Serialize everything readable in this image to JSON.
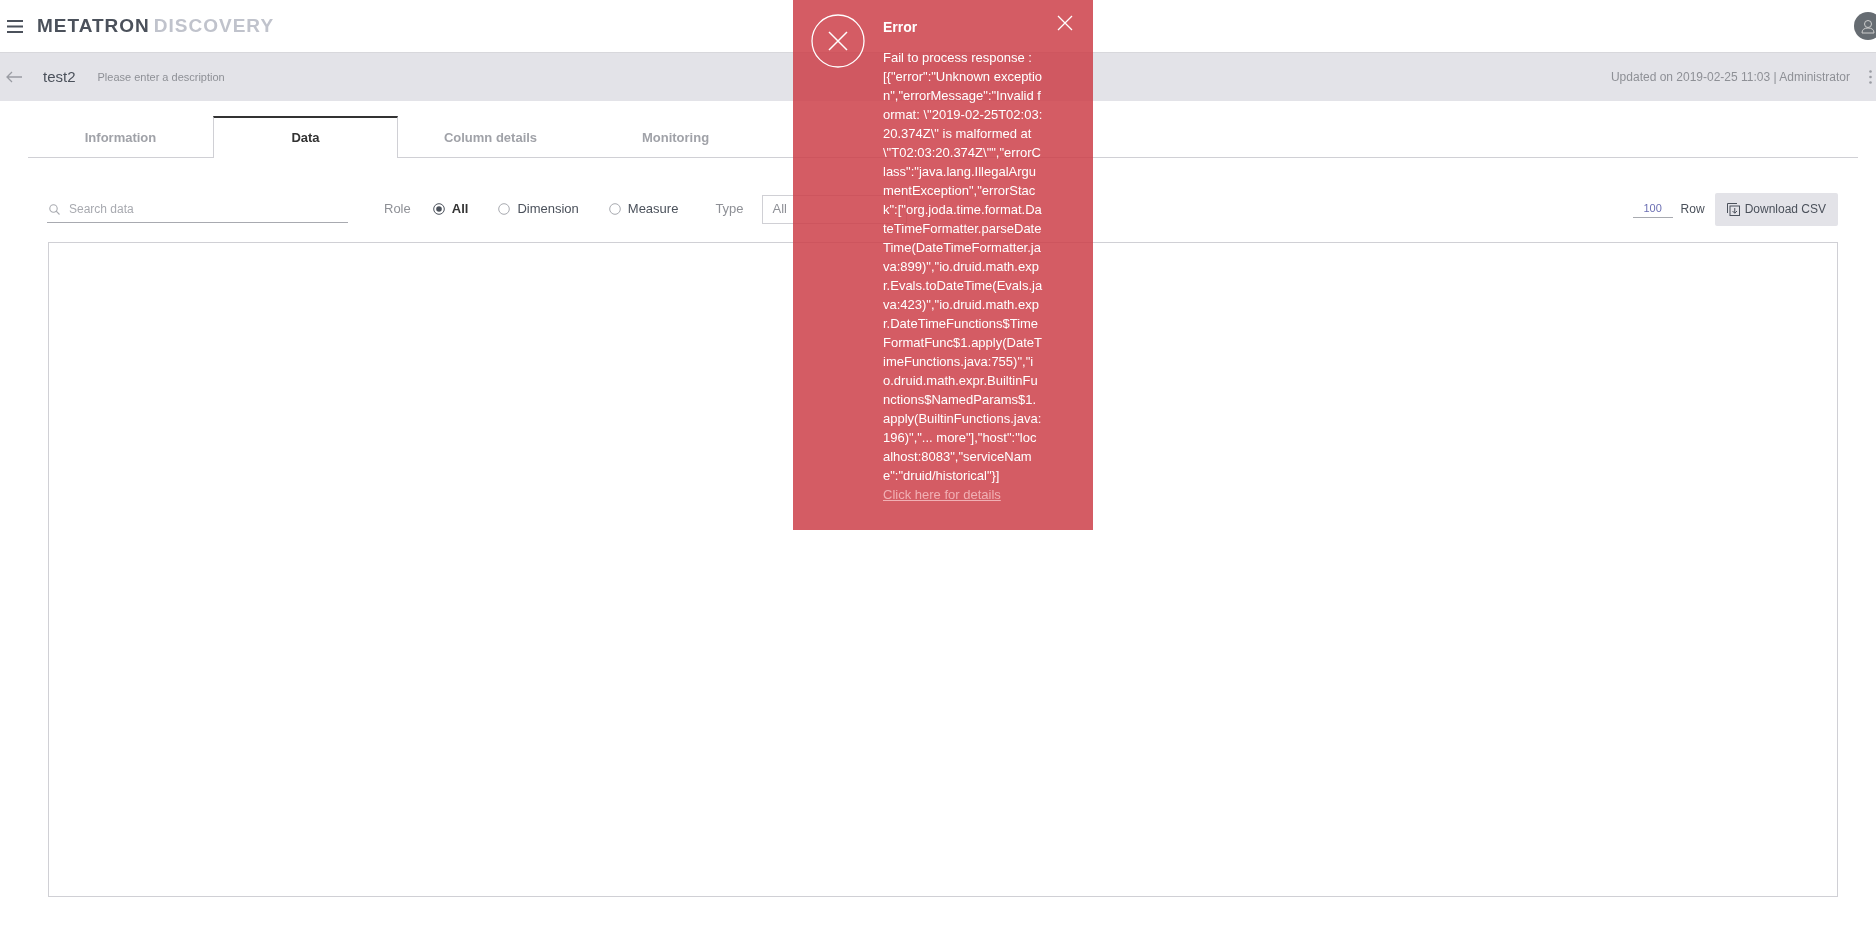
{
  "header": {
    "logo_strong": "METATRON",
    "logo_light": "DISCOVERY"
  },
  "title_bar": {
    "title": "test2",
    "description": {
      "placeholder": "Please enter a description"
    },
    "updated": "Updated on 2019-02-25 11:03 | Administrator"
  },
  "tabs": [
    {
      "label": "Information",
      "selected": false
    },
    {
      "label": "Data",
      "selected": true
    },
    {
      "label": "Column details",
      "selected": false
    },
    {
      "label": "Monitoring",
      "selected": false
    }
  ],
  "toolbar": {
    "search": {
      "placeholder": "Search data"
    },
    "role_label": "Role",
    "role_options": [
      {
        "label": "All",
        "selected": true
      },
      {
        "label": "Dimension",
        "selected": false
      },
      {
        "label": "Measure",
        "selected": false
      }
    ],
    "type_label": "Type",
    "type_value": "All",
    "rows_value": "100",
    "rows_label": "Row",
    "download": "Download CSV"
  },
  "toast": {
    "title": "Error",
    "message": "Fail to process response : [{\"error\":\"Unknown exception\",\"errorMessage\":\"Invalid format: \\\"2019-02-25T02:03:20.374Z\\\" is malformed at \\\"T02:03:20.374Z\\\"\",\"errorClass\":\"java.lang.IllegalArgumentException\",\"errorStack\":[\"org.joda.time.format.DateTimeFormatter.parseDateTime(DateTimeFormatter.java:899)\",\"io.druid.math.expr.Evals.toDateTime(Evals.java:423)\",\"io.druid.math.expr.DateTimeFunctions$TimeFormatFunc$1.apply(DateTimeFunctions.java:755)\",\"io.druid.math.expr.BuiltinFunctions$NamedParams$1.apply(BuiltinFunctions.java:196)\",\"... more\"],\"host\":\"localhost:8083\",\"serviceName\":\"druid/historical\"}]",
    "link": "Click here for details"
  }
}
